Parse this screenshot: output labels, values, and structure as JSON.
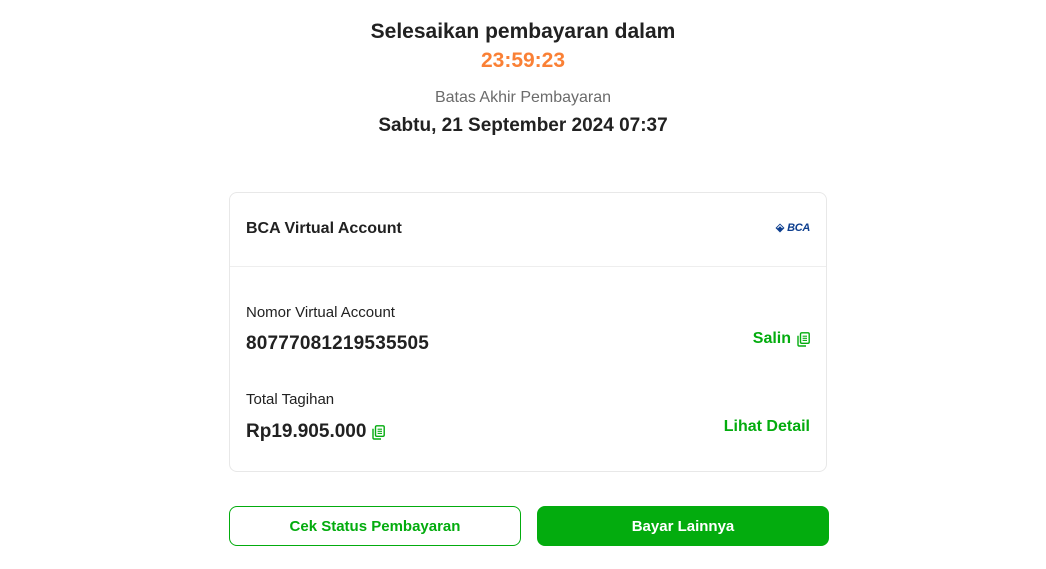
{
  "header": {
    "title": "Selesaikan pembayaran dalam",
    "countdown": "23:59:23",
    "deadline_label": "Batas Akhir Pembayaran",
    "deadline_value": "Sabtu, 21 September 2024 07:37"
  },
  "payment": {
    "method_name": "BCA Virtual Account",
    "bank_logo_text": "BCA",
    "va_label": "Nomor Virtual Account",
    "va_number": "80777081219535505",
    "copy_label": "Salin",
    "total_label": "Total Tagihan",
    "total_value": "Rp19.905.000",
    "detail_label": "Lihat Detail"
  },
  "actions": {
    "check_status_label": "Cek Status Pembayaran",
    "pay_other_label": "Bayar Lainnya"
  },
  "colors": {
    "accent_green": "#03ac0e",
    "countdown_orange": "#fa8035",
    "bank_blue": "#0e3f8f"
  },
  "icons": {
    "copy": "copy-icon",
    "bank": "bca-logo-icon"
  }
}
